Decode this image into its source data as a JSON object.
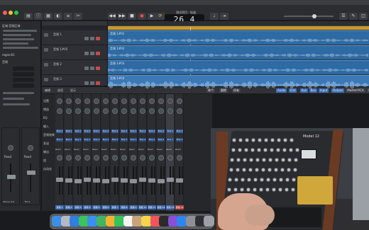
{
  "app": {
    "project_title": "测试项目 - 轨道",
    "lcd_position": "26 4"
  },
  "inspector": {
    "header": "区域:音频区域",
    "region_name": "region01",
    "track_label": "音频",
    "strip_a_label": "Stereo Out",
    "strip_b_label": "Bnce",
    "read_label": "Read",
    "read_label_2": "Read"
  },
  "tracks": [
    {
      "label": "音频 1",
      "region": "音频 1#01"
    },
    {
      "label": "音频 1#05",
      "region": "音频 1#02"
    },
    {
      "label": "音频 2",
      "region": "音频 1#03"
    },
    {
      "label": "音频 3",
      "region": "音频 1#04"
    }
  ],
  "mixer": {
    "toolbar_tabs": [
      "编辑",
      "选项",
      "显示",
      "单个",
      "跟踪",
      "多个",
      "所有"
    ],
    "filter_buttons": [
      "Audio",
      "Inst",
      "Aux",
      "Bus",
      "Input",
      "Output",
      "Master/VCA",
      "MIDI"
    ],
    "row_labels": [
      "设置",
      "增益",
      "EQ",
      "输入",
      "音频效果",
      "发送",
      "输出",
      "组",
      "自动化"
    ],
    "send_label": "Bus 1",
    "read_label": "Read",
    "channels": [
      "音频 1",
      "音频 2",
      "音频 3",
      "音频 4",
      "音频 5",
      "音频 6",
      "音频 7",
      "音频 8",
      "音频 9",
      "音频 10",
      "音频 11",
      "音频 12",
      "音频 13",
      "音频 14",
      "Stereo Out",
      "Master"
    ]
  },
  "video": {
    "device_logo": "Model 12"
  },
  "colors": {
    "region_blue": "#2e6aa3",
    "cycle_yellow": "#c59b2e",
    "channel_blue": "#3d6bb1",
    "wood": "#6b3a22",
    "panel_gold": "#cfa73a"
  },
  "dock": {
    "icons": [
      "finder-icon",
      "launchpad-icon",
      "safari-icon",
      "messages-icon",
      "mail-icon",
      "maps-icon",
      "photos-icon",
      "facetime-icon",
      "calendar-icon",
      "contacts-icon",
      "notes-icon",
      "music-icon",
      "tv-icon",
      "podcasts-icon",
      "appstore-icon",
      "settings-icon",
      "logic-icon",
      "trash-icon"
    ]
  }
}
